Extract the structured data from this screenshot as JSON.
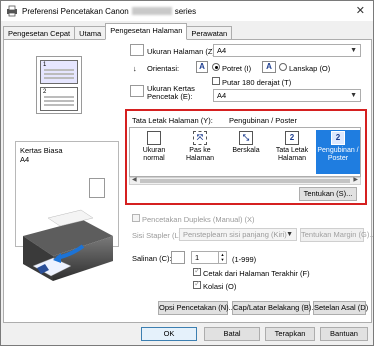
{
  "window": {
    "title_prefix": "Preferensi Pencetakan Canon",
    "title_suffix": "series"
  },
  "tabs": [
    "Pengesetan Cepat",
    "Utama",
    "Pengesetan Halaman",
    "Perawatan"
  ],
  "page_size": {
    "label": "Ukuran Halaman (Z):",
    "value": "A4"
  },
  "orientation": {
    "label": "Orientasi:",
    "portrait": "Potret (I)",
    "landscape": "Lanskap (O)",
    "rotate": "Putar 180 derajat (T)"
  },
  "paper_size": {
    "label": "Ukuran Kertas Pencetak (E):",
    "value": "A4"
  },
  "paper_info": {
    "type": "Kertas Biasa",
    "size": "A4"
  },
  "layout": {
    "label": "Tata Letak Halaman (Y):",
    "current": "Pengubinan / Poster",
    "items": [
      "Ukuran normal",
      "Pas ke Halaman",
      "Berskala",
      "Tata Letak Halaman",
      "Pengubinan / Poster"
    ],
    "specify_button": "Tentukan (S)..."
  },
  "preview": {
    "page1": "1",
    "page2": "2"
  },
  "duplex": {
    "label": "Pencetakan Dupleks (Manual) (X)"
  },
  "stapling": {
    "label": "Sisi Stapler (L):",
    "value": "Pensteplearn sisi panjang (Kiri)",
    "margin_button": "Tentukan Margin (G)..."
  },
  "copies": {
    "label": "Salinan (C):",
    "value": "1",
    "range": "(1-999)",
    "last_page_first": "Cetak dari Halaman Terakhir (F)",
    "collate": "Kolasi (O)"
  },
  "bottom_buttons": [
    "Opsi Pencetakan (N)...",
    "Cap/Latar Belakang (B)...",
    "Setelan Asal (D)"
  ],
  "dialog_buttons": [
    "OK",
    "Batal",
    "Terapkan",
    "Bantuan"
  ]
}
